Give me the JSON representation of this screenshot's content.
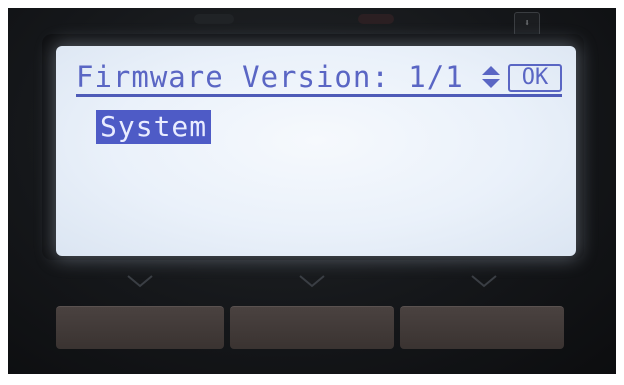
{
  "screen": {
    "title": "Firmware Version: 1/1",
    "ok_label": "OK",
    "selected_item": "System"
  },
  "top_badge": "⬇",
  "icons": {
    "scroll": "up-down-arrow-icon",
    "softkeys": [
      "chevron-down-icon",
      "chevron-down-icon",
      "chevron-down-icon"
    ]
  },
  "colors": {
    "lcd_background": "#eaf1fa",
    "lcd_text": "#5a66c4",
    "highlight": "#4e5bc6",
    "panel": "#15171a",
    "softkey": "#3f3735"
  }
}
